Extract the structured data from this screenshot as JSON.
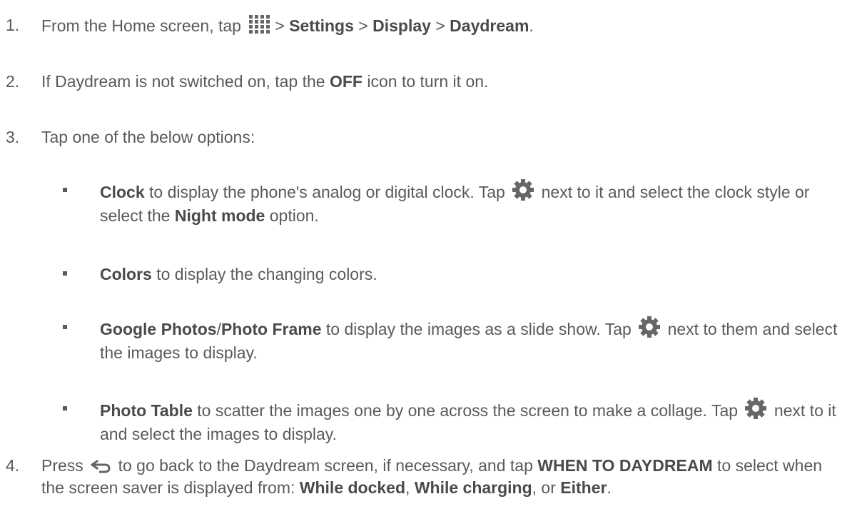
{
  "steps": [
    {
      "number": "1.",
      "t1": "From the Home screen, tap",
      "t2": ">",
      "b1": "Settings",
      "t3": ">",
      "b2": "Display",
      "t4": ">",
      "b3": "Daydream",
      "t5": "."
    },
    {
      "number": "2.",
      "t1": "If Daydream is not switched on, tap the",
      "b1": "OFF",
      "t2": "icon to turn it on."
    },
    {
      "number": "3.",
      "t1": "Tap one of the below options:"
    },
    {
      "number": "4.",
      "t1": "Press",
      "t2": "to go back to the Daydream screen, if necessary, and tap",
      "b1": "WHEN TO DAYDREAM",
      "t3": "to select when the screen saver is displayed from:",
      "b2": "While docked",
      "t4": ",",
      "b3": "While charging",
      "t5": ", or",
      "b4": "Either",
      "t6": "."
    }
  ],
  "options": [
    {
      "b1": "Clock",
      "t1": "to display the phone's analog or digital clock. Tap",
      "t2": "next to it and select the clock style or select the",
      "b2": "Night mode",
      "t3": "option."
    },
    {
      "b1": "Colors",
      "t1": "to display the changing colors."
    },
    {
      "b1": "Google Photos",
      "t1": "/",
      "b2": "Photo Frame",
      "t2": "to display the images as a slide show. Tap",
      "t3": "next to them and select the images to display."
    },
    {
      "b1": "Photo Table",
      "t1": "to scatter the images one by one across the screen to make a collage. Tap",
      "t2": "next to it and select the images to display."
    }
  ],
  "icons": {
    "apps": "apps-grid-icon",
    "settings": "gear-icon",
    "back": "back-arrow-icon"
  },
  "colors": {
    "text": "#5a5a5a",
    "bold": "#4a4a4a",
    "icon": "#666666"
  }
}
